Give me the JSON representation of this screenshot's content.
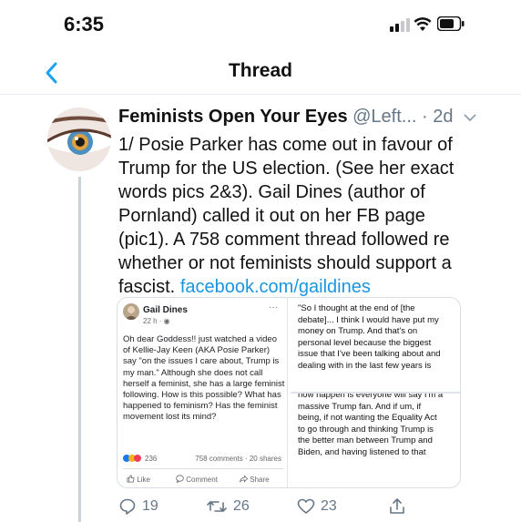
{
  "status_bar": {
    "time": "6:35",
    "icons": [
      "signal-icon",
      "wifi-icon",
      "battery-icon"
    ]
  },
  "nav": {
    "title": "Thread",
    "back_icon": "chevron-left-icon",
    "accent_color": "#1da1f2"
  },
  "tweet": {
    "display_name": "Feminists Open Your Eyes",
    "handle": "@Left...",
    "time_ago": "· 2d",
    "text": "1/ Posie Parker has come out in favour of Trump for the US election. (See her exact words pics 2&3). Gail Dines (author of Pornland) called it out on her FB page (pic1).  A 758 comment thread followed re whether or not feminists should support a fascist.",
    "link": "facebook.com/gaildines",
    "link_color": "#1b95e0",
    "media": {
      "pic1": {
        "name": "Gail Dines",
        "meta": "22 h · ◉",
        "more": "···",
        "post": "Oh dear Goddess!! just watched a video of Kellie-Jay Keen (AKA Posie Parker) say \"on the issues I care about, Trump is my man.\" Although she does not call herself a feminist, she has a large feminist following. How is this possible? What has happened to feminism? Has the feminist movement lost its mind?",
        "reaction_count": "236",
        "comments_shares": "758 comments · 20 shares",
        "like": "Like",
        "comment": "Comment",
        "share": "Share"
      },
      "pic2": {
        "text": "\"So I thought at the end of [the debate]... I think I would have put my money on Trump. And that's on personal level because the biggest issue that I've been talking about and dealing with in the last few years is"
      },
      "pic3": {
        "text": "now happen is everyone will say I'm a massive Trump fan. And if um, if being, if not wanting the Equality Act to go through and thinking Trump is the better man between Trump and Biden, and having listened to that"
      }
    },
    "actions": {
      "replies": "19",
      "retweets": "26",
      "likes": "23"
    }
  }
}
